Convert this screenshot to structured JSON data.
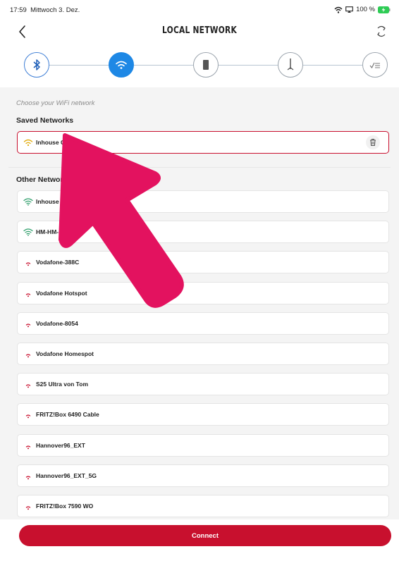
{
  "status_bar": {
    "time": "17:59",
    "date": "Mittwoch 3. Dez.",
    "battery": "100 %"
  },
  "nav": {
    "title": "LOCAL NETWORK"
  },
  "stepper": {
    "steps": [
      "bluetooth-icon",
      "wifi-icon",
      "device-icon",
      "antenna-icon",
      "checklist-icon"
    ],
    "active_step": 2
  },
  "caption": "Choose your WiFi network",
  "saved": {
    "title": "Saved Networks",
    "networks": [
      {
        "name": "Inhouse G…Hz",
        "signal": "medium",
        "selected": true
      }
    ]
  },
  "other": {
    "title": "Other Networks",
    "networks": [
      {
        "name": "Inhouse Go",
        "signal": "strong"
      },
      {
        "name": "HM-HM-Gas",
        "signal": "strong"
      },
      {
        "name": "Vodafone-388C",
        "signal": "weak"
      },
      {
        "name": "Vodafone Hotspot",
        "signal": "weak"
      },
      {
        "name": "Vodafone-8054",
        "signal": "weak"
      },
      {
        "name": "Vodafone Homespot",
        "signal": "weak"
      },
      {
        "name": "S25 Ultra von Tom",
        "signal": "weak"
      },
      {
        "name": "FRITZ!Box 6490 Cable",
        "signal": "weak"
      },
      {
        "name": "Hannover96_EXT",
        "signal": "weak"
      },
      {
        "name": "Hannover96_EXT_5G",
        "signal": "weak"
      },
      {
        "name": "FRITZ!Box 7590 WO",
        "signal": "weak"
      }
    ]
  },
  "connect_label": "Connect",
  "colors": {
    "accent": "#c8102e",
    "step_active": "#1e88e5",
    "signal_strong": "#2e9e6a",
    "signal_medium": "#e0a800",
    "signal_weak": "#c8102e"
  }
}
